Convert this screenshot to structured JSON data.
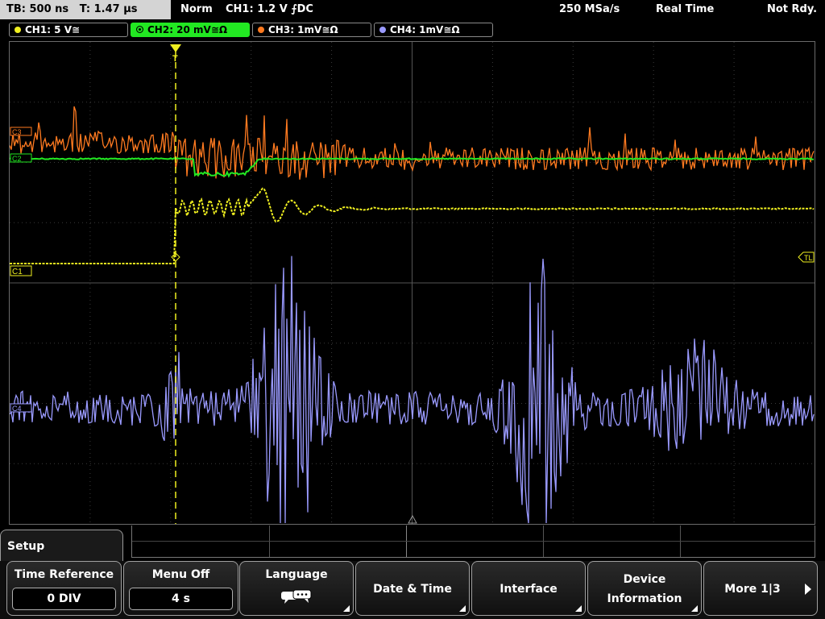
{
  "status_bar": {
    "timebase": "TB: 500 ns",
    "trigger_time": "T: 1.47 µs",
    "mode": "Norm",
    "trigger": "CH1: 1.2 V ⨍DC",
    "sample_rate": "250 MSa/s",
    "acquisition": "Real Time",
    "state": "Not Rdy."
  },
  "channels": [
    {
      "label": "CH1: 5 V≅",
      "color": "#f0f020",
      "active": false
    },
    {
      "label": "CH2: 20 mV≅Ω",
      "color": "#22e822",
      "active": true
    },
    {
      "label": "CH3: 1mV≅Ω",
      "color": "#ff7a20",
      "active": false
    },
    {
      "label": "CH4: 1mV≅Ω",
      "color": "#9a9aff",
      "active": false
    }
  ],
  "markers": {
    "ch1": "C1",
    "ch2": "C2",
    "ch3": "C3",
    "ch4": "C4",
    "trigger_level": "TL",
    "trigger_pos": "T"
  },
  "menu": {
    "title": "Setup",
    "softkeys": [
      {
        "label": "Time Reference",
        "value": "0 DIV"
      },
      {
        "label": "Menu Off",
        "value": "4 s"
      },
      {
        "label": "Language",
        "icon": "speech-bubbles-icon"
      },
      {
        "label": "Date & Time"
      },
      {
        "label": "Interface"
      },
      {
        "label": "Device",
        "label2": "Information"
      },
      {
        "label": "More 1|3",
        "icon": "arrow-right-icon"
      }
    ]
  }
}
